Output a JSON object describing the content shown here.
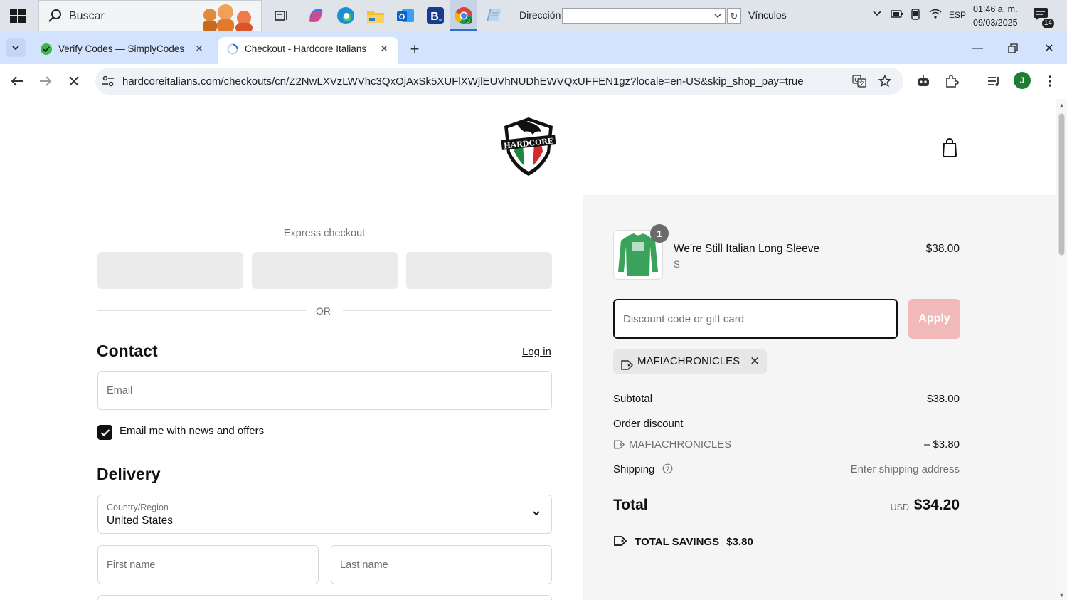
{
  "taskbar": {
    "search_placeholder": "Buscar",
    "address_label": "Dirección",
    "address_value": "",
    "links_label": "Vínculos",
    "language": "ESP",
    "time": "01:46 a. m.",
    "date": "09/03/2025",
    "notification_count": "14",
    "apps": [
      "task-view-icon",
      "copilot-icon",
      "edge-icon",
      "file-explorer-icon",
      "outlook-icon",
      "booking-icon",
      "chrome-icon",
      "notepad-icon"
    ]
  },
  "browser": {
    "tabs": [
      {
        "title": "Verify Codes — SimplyCodes",
        "icon": "simplycodes-icon"
      },
      {
        "title": "Checkout - Hardcore Italians",
        "icon": "loading-icon"
      }
    ],
    "url": "hardcoreitalians.com/checkouts/cn/Z2NwLXVzLWVhc3QxOjAxSk5XUFlXWjlEUVhNUDhEWVQxUFFEN1gz?locale=en-US&skip_shop_pay=true",
    "profile_initial": "J"
  },
  "checkout": {
    "express_label": "Express checkout",
    "or_label": "OR",
    "contact_title": "Contact",
    "login_label": "Log in",
    "email_placeholder": "Email",
    "newsletter_label": "Email me with news and offers",
    "newsletter_checked": true,
    "delivery_title": "Delivery",
    "country_label": "Country/Region",
    "country_value": "United States",
    "first_name_placeholder": "First name",
    "last_name_placeholder": "Last name"
  },
  "summary": {
    "product_name": "We're Still Italian Long Sleeve",
    "product_variant": "S",
    "product_qty": "1",
    "product_price": "$38.00",
    "discount_placeholder": "Discount code or gift card",
    "apply_label": "Apply",
    "applied_code": "MAFIACHRONICLES",
    "subtotal_label": "Subtotal",
    "subtotal_value": "$38.00",
    "order_discount_label": "Order discount",
    "discount_code": "MAFIACHRONICLES",
    "discount_value": "– $3.80",
    "shipping_label": "Shipping",
    "shipping_value": "Enter shipping address",
    "total_label": "Total",
    "total_currency": "USD",
    "total_value": "$34.20",
    "savings_label": "TOTAL SAVINGS",
    "savings_value": "$3.80"
  },
  "colors": {
    "tabstrip": "#d3e3fd",
    "apply_disabled": "#f1b9b9",
    "summary_bg": "#f5f5f5"
  }
}
